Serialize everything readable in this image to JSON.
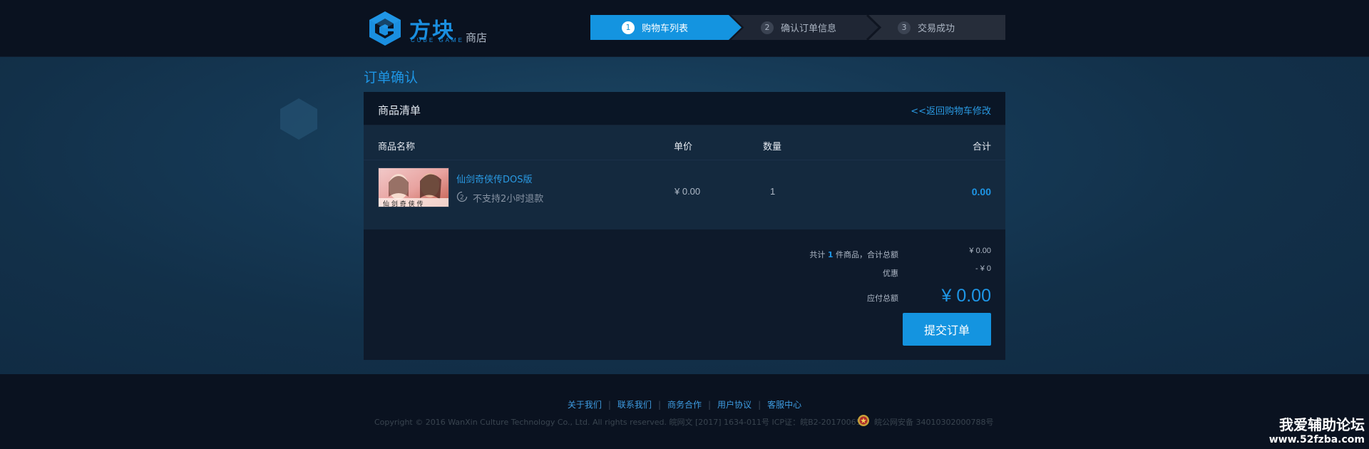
{
  "header": {
    "logo_cn": "方块",
    "logo_en": "CUBE GAME",
    "shop_label": "商店",
    "steps": [
      {
        "num": "1",
        "label": "购物车列表"
      },
      {
        "num": "2",
        "label": "确认订单信息"
      },
      {
        "num": "3",
        "label": "交易成功"
      }
    ]
  },
  "main": {
    "page_title": "订单确认",
    "panel_title": "商品清单",
    "back_link": "<<返回购物车修改",
    "columns": {
      "name": "商品名称",
      "price": "单价",
      "qty": "数量",
      "total": "合计"
    },
    "item": {
      "name": "仙剑奇侠传DOS版",
      "refund_note": "不支持2小时退款",
      "price": "¥ 0.00",
      "qty": "1",
      "total": "0.00"
    },
    "summary": {
      "count_prefix": "共计 ",
      "count": "1",
      "count_suffix": " 件商品，合计总额",
      "subtotal": "¥ 0.00",
      "discount_label": "优惠",
      "discount": "- ¥ 0",
      "payable_label": "应付总额",
      "payable": "¥ 0.00"
    },
    "submit_label": "提交订单"
  },
  "footer": {
    "links": [
      "关于我们",
      "联系我们",
      "商务合作",
      "用户协议",
      "客服中心"
    ],
    "copyright": "Copyright © 2016 WanXin Culture Technology Co., Ltd. All rights reserved. 皖网文 [2017] 1634-011号 ICP证：皖B2-20170065",
    "police": "皖公网安备 34010302000788号"
  },
  "watermark": {
    "line1": "我爱辅助论坛",
    "line2": "www.52fzba.com"
  },
  "colors": {
    "accent": "#1494e0",
    "header_bg": "#0a1220",
    "panel_bg": "#0e1a2b"
  }
}
